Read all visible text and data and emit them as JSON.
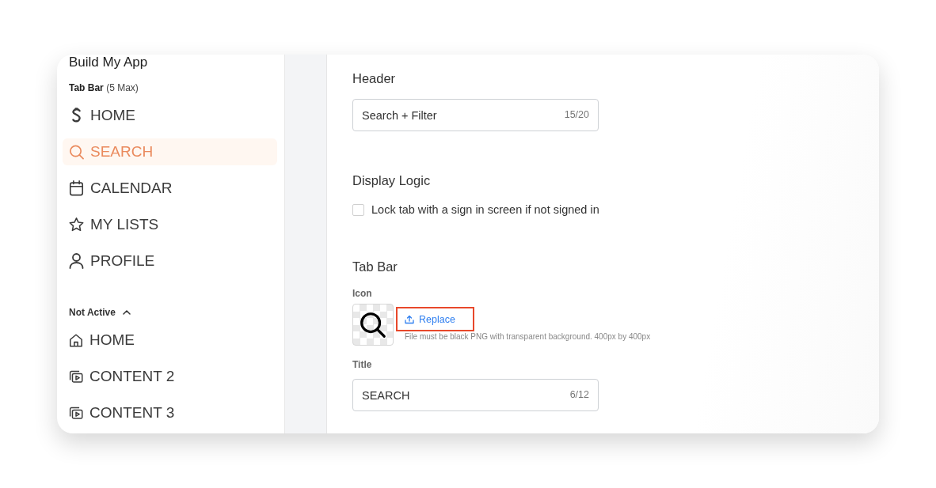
{
  "sidebar": {
    "app_title": "Build My App",
    "tab_bar": {
      "label": "**Tab Bar** (5 Max)",
      "items": [
        {
          "label": "HOME",
          "selected": false
        },
        {
          "label": "SEARCH",
          "selected": true
        },
        {
          "label": "CALENDAR",
          "selected": false
        },
        {
          "label": "MY LISTS",
          "selected": false
        },
        {
          "label": "PROFILE",
          "selected": false
        }
      ]
    },
    "not_active": {
      "label": "Not Active",
      "expanded": true,
      "items": [
        {
          "label": "HOME",
          "selected": false
        },
        {
          "label": "CONTENT 2",
          "selected": false
        },
        {
          "label": "CONTENT 3",
          "selected": false
        }
      ]
    }
  },
  "main": {
    "header": {
      "label": "Header",
      "value": "Search + Filter",
      "counter": "15/20"
    },
    "display_logic": {
      "label": "Display Logic",
      "checkbox": {
        "label": "Lock tab with a sign in screen if not signed in",
        "checked": false
      }
    },
    "tab_bar": {
      "label": "Tab Bar",
      "icon": {
        "label": "Icon",
        "replace": {
          "label": "Replace",
          "highlighted": true
        },
        "hint": "File must be black PNG with transparent background. 400px by 400px"
      },
      "title": {
        "label": "Title",
        "value": "SEARCH",
        "counter": "6/12"
      }
    }
  }
}
